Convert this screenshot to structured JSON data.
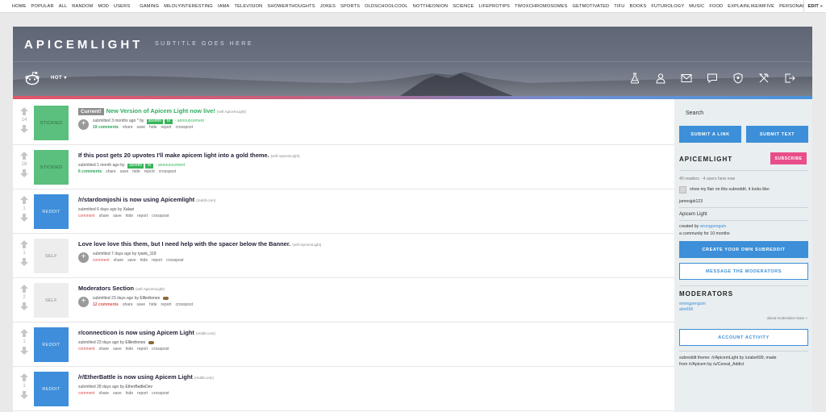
{
  "topbar": {
    "links": [
      "HOME",
      "POPULAR",
      "ALL",
      "RANDOM",
      "MOD",
      "USERS"
    ],
    "subreddits": [
      "GAMING",
      "MILDLYINTERESTING",
      "IAMA",
      "TELEVISION",
      "SHOWERTHOUGHTS",
      "JOKES",
      "SPORTS",
      "OLDSCHOOLCOOL",
      "NOTTHEONION",
      "SCIENCE",
      "LIFEPROTIPS",
      "TWOXCHROMOSOMES",
      "GETMOTIVATED",
      "TIFU",
      "BOOKS",
      "FUTUROLOGY",
      "MUSIC",
      "FOOD",
      "EXPLAINLIKEIMFIVE",
      "PERSONALFINANCE",
      "PHOTOSHOPB"
    ],
    "edit_label": "EDIT"
  },
  "header": {
    "title": "APICEMLIGHT",
    "subtitle": "SUBTITLE GOES HERE",
    "sort_label": "HOT",
    "icons": [
      "flask-icon",
      "user-icon",
      "mail-icon",
      "chat-icon",
      "shield-icon",
      "tools-icon",
      "logout-icon"
    ],
    "gradient_colors": [
      "#e2566a",
      "#4a93da"
    ]
  },
  "posts": [
    {
      "score": "14",
      "thumb": "STICKIED",
      "thumb_style": "sticky",
      "flair": "Current!",
      "title": "New Version of Apicem Light now live!",
      "title_green": true,
      "domain": "(self.ApicemLight)",
      "submitted": "submitted 3 months ago * by",
      "user": "abe699",
      "tag": "M",
      "ann": "- announcement",
      "comments": "19 comments",
      "comments_style": "g",
      "plus": true
    },
    {
      "score": "28",
      "thumb": "STICKIED",
      "thumb_style": "sticky",
      "flair": "",
      "title": "If this post gets 20 upvotes I'll make apicem light into a gold theme.",
      "title_green": false,
      "domain": "(self.ApicemLight)",
      "submitted": "submitted 1 month ago by",
      "user": "abe699",
      "tag": "M",
      "ann": "- announcement",
      "comments": "6 comments",
      "comments_style": "g",
      "plus": false
    },
    {
      "score": "1",
      "thumb": "REDDIT",
      "thumb_style": "reddit",
      "flair": "",
      "title": "/r/stardomjoshi is now using Apicemlight",
      "title_green": false,
      "domain": "(reddit.com)",
      "submitted": "submitted 6 days ago by",
      "user": "Xalazi",
      "tag": "",
      "ann": "",
      "comments": "comment",
      "comments_style": "r",
      "plus": false
    },
    {
      "score": "1",
      "thumb": "SELF",
      "thumb_style": "self",
      "flair": "",
      "title": "Love love love this them, but I need help with the spacer below the Banner.",
      "title_green": false,
      "domain": "(self.ApicemLight)",
      "submitted": "submitted 7 days ago by",
      "user": "ryank_119",
      "tag": "",
      "ann": "",
      "comments": "comment",
      "comments_style": "r",
      "plus": true
    },
    {
      "score": "2",
      "thumb": "SELF",
      "thumb_style": "self",
      "flair": "",
      "title": "Moderators Section",
      "title_green": false,
      "domain": "(self.ApicemLight)",
      "submitted": "submitted 23 days ago by",
      "user": "Ellledrones",
      "tag": "",
      "ann": "",
      "comments": "12 comments",
      "comments_style": "rb",
      "plus": true,
      "flag": true
    },
    {
      "score": "1",
      "thumb": "REDDIT",
      "thumb_style": "reddit",
      "flair": "",
      "title": "r/connecticon is now using Apicem Light",
      "title_green": false,
      "domain": "(reddit.com)",
      "submitted": "submitted 23 days ago by",
      "user": "Ellledrones",
      "tag": "",
      "ann": "",
      "comments": "comment",
      "comments_style": "r",
      "plus": false,
      "flag": true
    },
    {
      "score": "1",
      "thumb": "REDDIT",
      "thumb_style": "reddit",
      "flair": "",
      "title": "/r/EtherBattle is now using Apicem Light",
      "title_green": false,
      "domain": "(reddit.com)",
      "submitted": "submitted 28 days ago by",
      "user": "EtherBattleDev",
      "tag": "",
      "ann": "",
      "comments": "comment",
      "comments_style": "r",
      "plus": false
    }
  ],
  "post_actions": [
    "share",
    "save",
    "hide",
    "report",
    "crosspost"
  ],
  "sidebar": {
    "search_placeholder": "Search",
    "submit_link": "SUBMIT A LINK",
    "submit_text": "SUBMIT TEXT",
    "sub_name": "APICEMLIGHT",
    "subscribe": "SUBSCRIBE",
    "readers": "40 readers · 4 users here now",
    "flair_text": "show my flair on this subreddit. it looks like:",
    "flair_user": "jamesjpk123",
    "sub_desc": "Apicem Light",
    "created_by_label": "created by",
    "created_by_user": "wrongpenguin",
    "age": "a community for 10 months",
    "create_btn": "CREATE YOUR OWN SUBREDDIT",
    "message_btn": "MESSAGE THE MODERATORS",
    "mods_title": "MODERATORS",
    "mods": [
      "wrongpenguin",
      "abe699"
    ],
    "about_mods": "about moderation team »",
    "activity_btn": "ACCOUNT ACTIVITY",
    "theme_line1": "subreddit theme: /r/ApicemLight by /u/abe699, made",
    "theme_line2": "from /r/Apicem by /u/Cereal_Addict"
  }
}
